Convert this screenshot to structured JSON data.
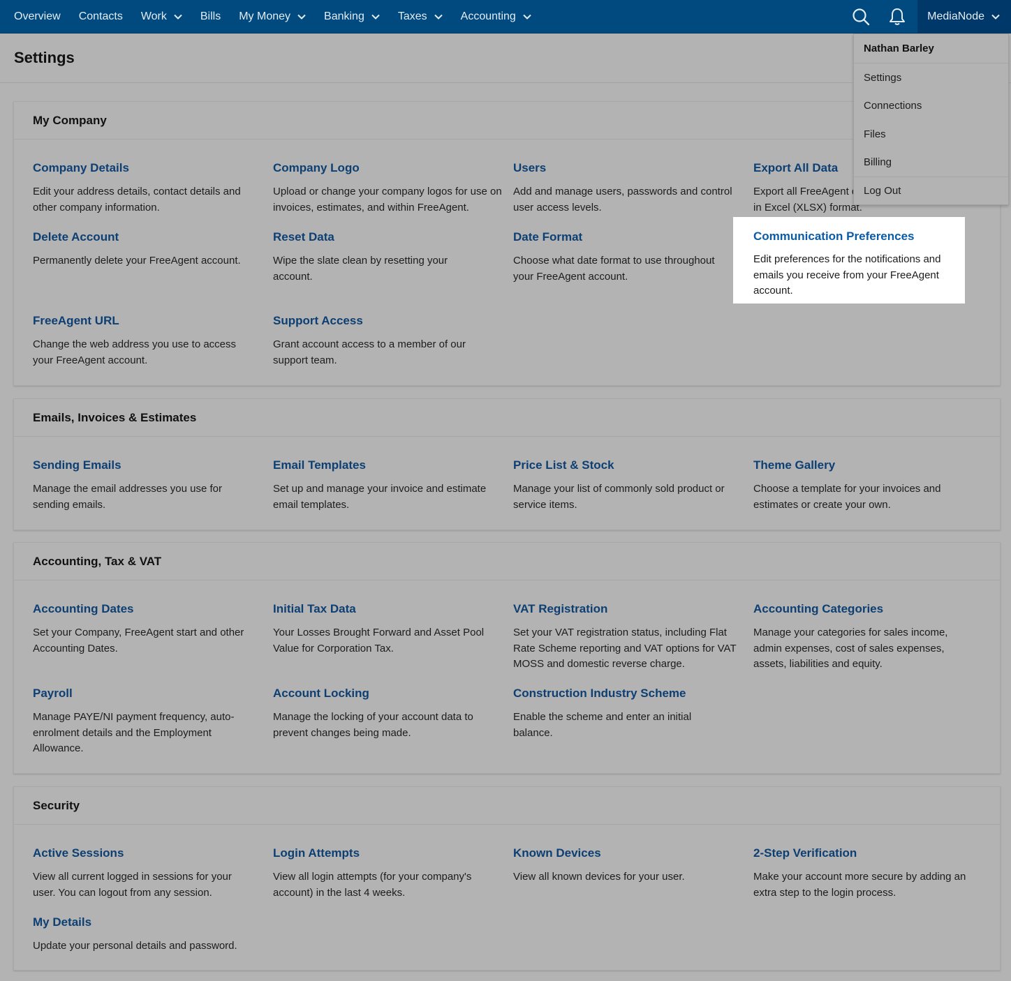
{
  "nav": {
    "items": [
      {
        "label": "Overview",
        "dropdown": false
      },
      {
        "label": "Contacts",
        "dropdown": false
      },
      {
        "label": "Work",
        "dropdown": true
      },
      {
        "label": "Bills",
        "dropdown": false
      },
      {
        "label": "My Money",
        "dropdown": true
      },
      {
        "label": "Banking",
        "dropdown": true
      },
      {
        "label": "Taxes",
        "dropdown": true
      },
      {
        "label": "Accounting",
        "dropdown": true
      }
    ],
    "account_label": "MediaNode",
    "search_icon": "search-icon",
    "bell_icon": "bell-icon"
  },
  "page": {
    "title": "Settings"
  },
  "sections": {
    "my_company": {
      "title": "My Company",
      "items": [
        {
          "title": "Company Details",
          "desc": "Edit your address details, contact details and other company information."
        },
        {
          "title": "Company Logo",
          "desc": "Upload or change your company logos for use on invoices, estimates, and within FreeAgent."
        },
        {
          "title": "Users",
          "desc": "Add and manage users, passwords and control user access levels."
        },
        {
          "title": "Export All Data",
          "desc": "Export all FreeAgent data in Excel (XLSX) format."
        },
        {
          "title": "Delete Account",
          "desc": "Permanently delete your FreeAgent account."
        },
        {
          "title": "Reset Data",
          "desc": "Wipe the slate clean by resetting your account."
        },
        {
          "title": "Date Format",
          "desc": "Choose what date format to use throughout your FreeAgent account."
        },
        {
          "title": "Communication Preferences",
          "desc": "Edit preferences for the notifications and emails you receive from your FreeAgent account."
        },
        {
          "title": "FreeAgent URL",
          "desc": "Change the web address you use to access your FreeAgent account."
        },
        {
          "title": "Support Access",
          "desc": "Grant account access to a member of our support team."
        }
      ]
    },
    "emails": {
      "title": "Emails, Invoices & Estimates",
      "items": [
        {
          "title": "Sending Emails",
          "desc": "Manage the email addresses you use for sending emails."
        },
        {
          "title": "Email Templates",
          "desc": "Set up and manage your invoice and estimate email templates."
        },
        {
          "title": "Price List & Stock",
          "desc": "Manage your list of commonly sold product or service items."
        },
        {
          "title": "Theme Gallery",
          "desc": "Choose a template for your invoices and estimates or create your own."
        }
      ]
    },
    "accounting": {
      "title": "Accounting, Tax & VAT",
      "items": [
        {
          "title": "Accounting Dates",
          "desc": "Set your Company, FreeAgent start and other Accounting Dates."
        },
        {
          "title": "Initial Tax Data",
          "desc": "Your Losses Brought Forward and Asset Pool Value for Corporation Tax."
        },
        {
          "title": "VAT Registration",
          "desc": "Set your VAT registration status, including Flat Rate Scheme reporting and VAT options for VAT MOSS and domestic reverse charge."
        },
        {
          "title": "Accounting Categories",
          "desc": "Manage your categories for sales income, admin expenses, cost of sales expenses, assets, liabilities and equity."
        },
        {
          "title": "Payroll",
          "desc": "Manage PAYE/NI payment frequency, auto-enrolment details and the Employment Allowance."
        },
        {
          "title": "Account Locking",
          "desc": "Manage the locking of your account data to prevent changes being made."
        },
        {
          "title": "Construction Industry Scheme",
          "desc": "Enable the scheme and enter an initial balance."
        }
      ]
    },
    "security": {
      "title": "Security",
      "items": [
        {
          "title": "Active Sessions",
          "desc": "View all current logged in sessions for your user. You can logout from any session."
        },
        {
          "title": "Login Attempts",
          "desc": "View all login attempts (for your company's account) in the last 4 weeks."
        },
        {
          "title": "Known Devices",
          "desc": "View all known devices for your user."
        },
        {
          "title": "2-Step Verification",
          "desc": "Make your account more secure by adding an extra step to the login process."
        },
        {
          "title": "My Details",
          "desc": "Update your personal details and password."
        }
      ]
    }
  },
  "dropdown": {
    "user_name": "Nathan Barley",
    "items": [
      "Settings",
      "Connections",
      "Files",
      "Billing",
      "Log Out"
    ]
  },
  "colors": {
    "nav_bg": "#004a80",
    "link": "#0d3f73",
    "highlight_link": "#0a5ba8",
    "overlay_bg": "#b3b3b3"
  }
}
